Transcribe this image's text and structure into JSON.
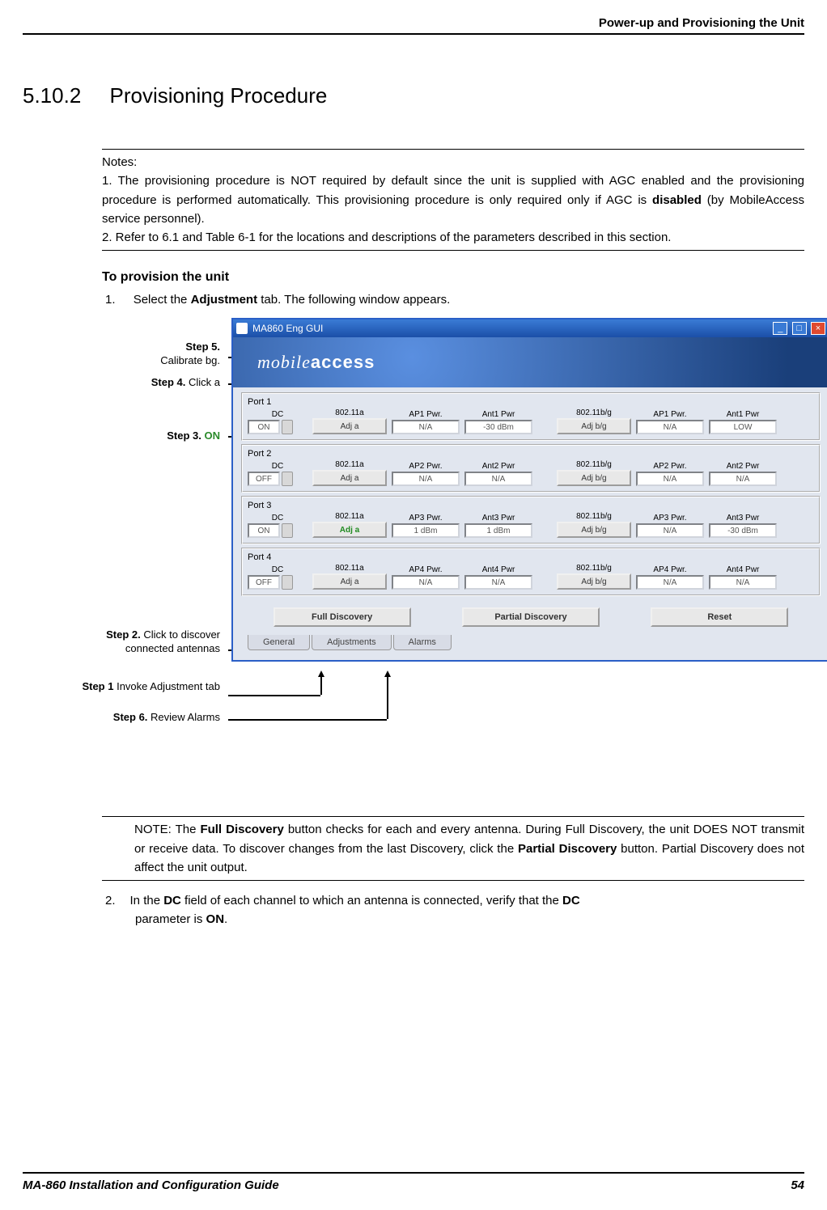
{
  "header": {
    "right": "Power-up and Provisioning the Unit"
  },
  "section": {
    "number": "5.10.2",
    "title": "Provisioning Procedure"
  },
  "notes": {
    "label": "Notes:",
    "n1": "1. The provisioning procedure is NOT required by default since the unit is supplied with AGC enabled and the provisioning procedure is performed automatically. This provisioning procedure is only required only if AGC is ",
    "n1_bold": "disabled",
    "n1_cont": " (by MobileAccess service personnel).",
    "n2": "2. Refer to  6.1 and Table  6-1 for the locations and descriptions of the parameters described in this section."
  },
  "subhead": "To provision the unit",
  "step1": {
    "num": "1.",
    "a": "Select the ",
    "b": "Adjustment",
    "c": " tab. The following window appears."
  },
  "callouts": {
    "s5": {
      "b": "Step 5.",
      "t": " Calibrate bg."
    },
    "s4": {
      "b": "Step 4.",
      "t": " Click a"
    },
    "s3": {
      "b": "Step 3. ",
      "on": "ON"
    },
    "s2": {
      "b": "Step 2.",
      "t": " Click to discover connected antennas"
    },
    "s1": {
      "b": "Step 1",
      "t": " Invoke Adjustment tab"
    },
    "s6": {
      "b": "Step 6.",
      "t": " Review Alarms"
    }
  },
  "window": {
    "title": "MA860    Eng GUI",
    "banner": {
      "a": "mobile",
      "b": "access"
    },
    "ports": [
      {
        "label": "Port 1",
        "dc": "ON",
        "adj_a": "Adj  a",
        "ap": "AP1 Pwr.",
        "ap_v": "N/A",
        "ant": "Ant1 Pwr",
        "ant_v": "-30 dBm",
        "adj_bg": "Adj b/g",
        "ap2": "AP1 Pwr.",
        "ap2_v": "N/A",
        "ant2": "Ant1 Pwr",
        "ant2_v": "LOW",
        "green": false
      },
      {
        "label": "Port 2",
        "dc": "OFF",
        "adj_a": "Adj  a",
        "ap": "AP2 Pwr.",
        "ap_v": "N/A",
        "ant": "Ant2 Pwr",
        "ant_v": "N/A",
        "adj_bg": "Adj b/g",
        "ap2": "AP2 Pwr.",
        "ap2_v": "N/A",
        "ant2": "Ant2 Pwr",
        "ant2_v": "N/A",
        "green": false
      },
      {
        "label": "Port 3",
        "dc": "ON",
        "adj_a": "Adj  a",
        "ap": "AP3 Pwr.",
        "ap_v": "1 dBm",
        "ant": "Ant3 Pwr",
        "ant_v": "1 dBm",
        "adj_bg": "Adj b/g",
        "ap2": "AP3 Pwr.",
        "ap2_v": "N/A",
        "ant2": "Ant3 Pwr",
        "ant2_v": "-30 dBm",
        "green": true
      },
      {
        "label": "Port 4",
        "dc": "OFF",
        "adj_a": "Adj  a",
        "ap": "AP4 Pwr.",
        "ap_v": "N/A",
        "ant": "Ant4 Pwr",
        "ant_v": "N/A",
        "adj_bg": "Adj b/g",
        "ap2": "AP4 Pwr.",
        "ap2_v": "N/A",
        "ant2": "Ant4 Pwr",
        "ant2_v": "N/A",
        "green": false
      }
    ],
    "col_80211a": "802.11a",
    "col_80211bg": "802.11b/g",
    "dc_label": "DC",
    "btns": {
      "full": "Full Discovery",
      "partial": "Partial Discovery",
      "reset": "Reset"
    },
    "tabs": [
      "General",
      "Adjustments",
      "Alarms"
    ]
  },
  "note2": {
    "pre": "NOTE: The ",
    "b1": "Full Discovery",
    "mid1": " button checks for each and every antenna. During Full Discovery, the unit DOES NOT transmit or receive data. To discover changes from the last Discovery, click the ",
    "b2": "Partial Discovery",
    "mid2": " button. Partial Discovery does not affect the unit output."
  },
  "step2": {
    "num": "2.",
    "a": "In the ",
    "b1": "DC",
    "mid": " field of each channel to which an antenna is connected, verify that the ",
    "b2": "DC",
    "c": " parameter is ",
    "b3": "ON",
    "d": "."
  },
  "footer": {
    "left": "MA-860 Installation and Configuration Guide",
    "right": "54"
  }
}
